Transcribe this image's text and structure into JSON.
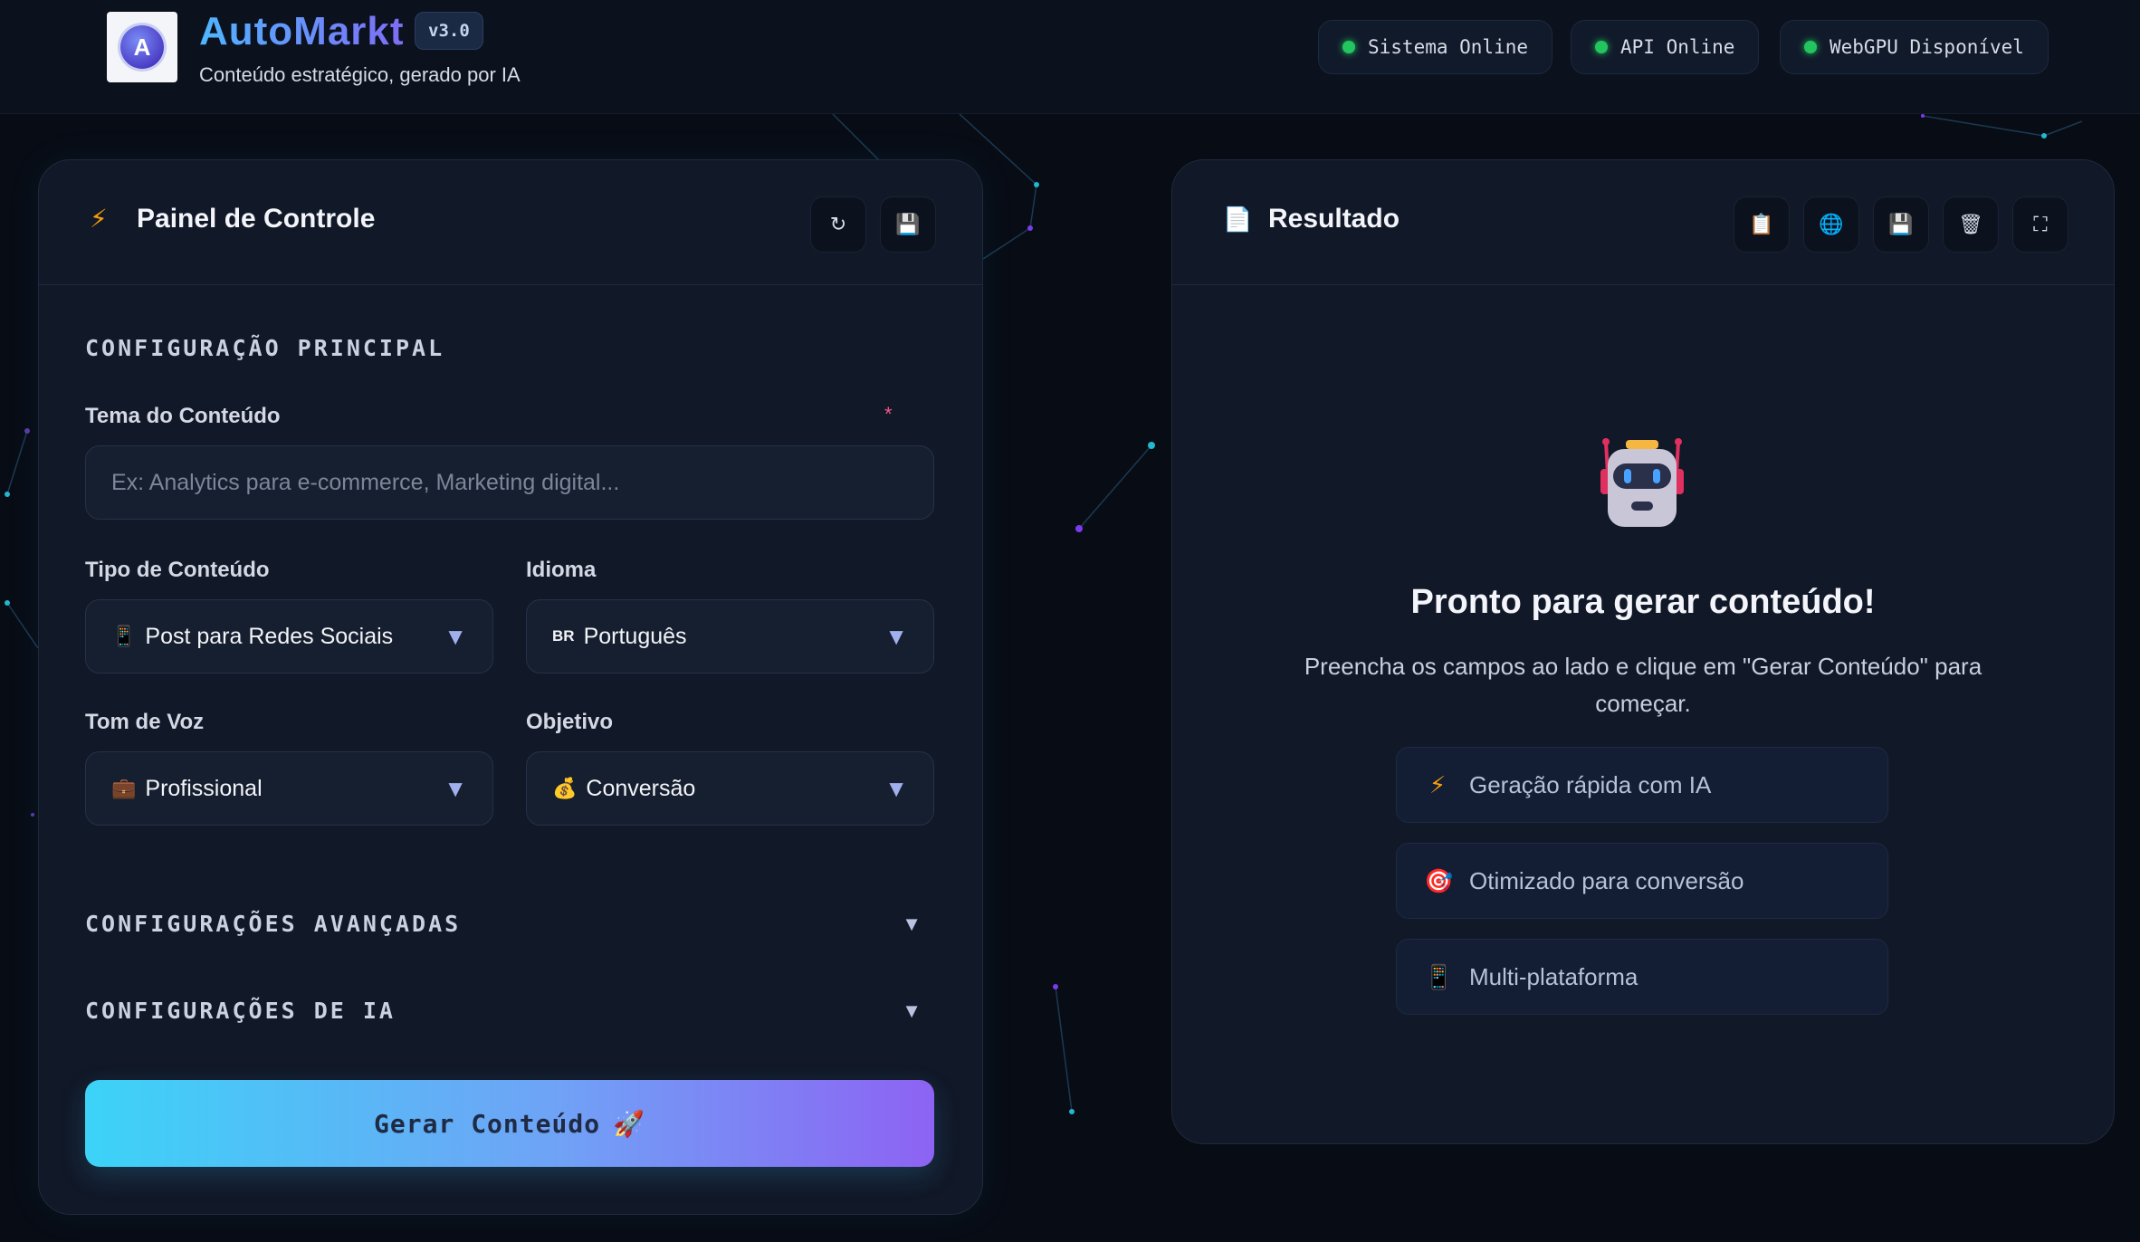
{
  "header": {
    "brand": "AutoMarkt",
    "version": "v3.0",
    "subtitle": "Conteúdo estratégico, gerado por IA",
    "statuses": [
      "Sistema Online",
      "API Online",
      "WebGPU Disponível"
    ]
  },
  "control_panel": {
    "title": "Painel de Controle",
    "section_main": "CONFIGURAÇÃO PRINCIPAL",
    "theme_label": "Tema do Conteúdo",
    "required_mark": "*",
    "theme_placeholder": "Ex: Analytics para e-commerce, Marketing digital...",
    "type_label": "Tipo de Conteúdo",
    "type_value": "Post para Redes Sociais",
    "language_label": "Idioma",
    "language_flag": "BR",
    "language_value": "Português",
    "tone_label": "Tom de Voz",
    "tone_value": "Profissional",
    "goal_label": "Objetivo",
    "goal_value": "Conversão",
    "section_advanced": "CONFIGURAÇÕES AVANÇADAS",
    "section_ai": "CONFIGURAÇÕES DE IA",
    "generate_label": "Gerar Conteúdo"
  },
  "result_panel": {
    "title": "Resultado",
    "ready_title": "Pronto para gerar conteúdo!",
    "ready_text": "Preencha os campos ao lado e clique em \"Gerar Conteúdo\" para começar.",
    "features": [
      "Geração rápida com IA",
      "Otimizado para conversão",
      "Multi-plataforma"
    ]
  },
  "icons": {
    "bolt": "⚡",
    "refresh": "↻",
    "save": "💾",
    "document": "📄",
    "clipboard": "📋",
    "globe": "🌐",
    "trash": "🗑",
    "fullscreen": "⛶",
    "phone": "📱",
    "briefcase": "💼",
    "money_bag": "💰",
    "rocket": "🚀",
    "target": "🎯",
    "caret": "▼"
  },
  "colors": {
    "status_online": "#22c55e",
    "accent_start": "#3cd3f7",
    "accent_end": "#8d63f3",
    "required": "#f0568a"
  }
}
